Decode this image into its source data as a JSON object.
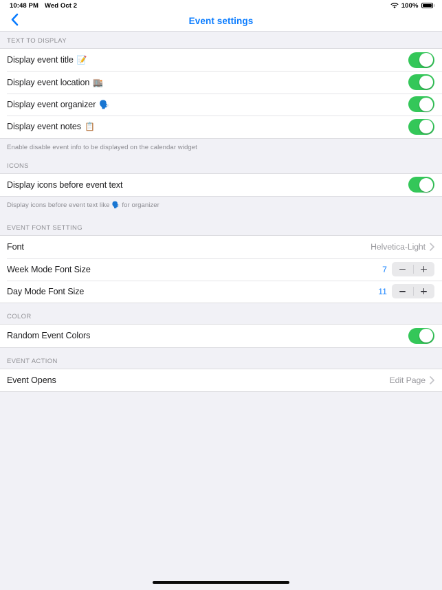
{
  "status_bar": {
    "time": "10:48 PM",
    "date": "Wed Oct 2",
    "wifi_icon": "wifi-icon",
    "battery_percent": "100%",
    "battery_icon": "battery-full-icon"
  },
  "nav": {
    "back_icon": "chevron-left-icon",
    "title": "Event settings",
    "title_color": "#0a7cff"
  },
  "sections": [
    {
      "header": "TEXT TO DISPLAY",
      "footer": "Enable disable event info to be displayed on the calendar widget",
      "rows": [
        {
          "label": "Display event title",
          "emoji": "📝",
          "emoji_name": "memo-emoji",
          "control": "toggle",
          "value": "on"
        },
        {
          "label": "Display event location",
          "emoji": "🏬",
          "emoji_name": "department-store-emoji",
          "control": "toggle",
          "value": "on"
        },
        {
          "label": "Display event organizer",
          "emoji": "🗣️",
          "emoji_name": "speaking-head-emoji",
          "control": "toggle",
          "value": "on"
        },
        {
          "label": "Display event notes",
          "emoji": "📋",
          "emoji_name": "clipboard-emoji",
          "control": "toggle",
          "value": "on"
        }
      ]
    },
    {
      "header": "ICONS",
      "footer_prefix": "Display icons before event text like",
      "footer_emoji": "🗣️",
      "footer_suffix": "for organizer",
      "rows": [
        {
          "label": "Display icons before event text",
          "control": "toggle",
          "value": "on"
        }
      ]
    },
    {
      "header": "EVENT FONT SETTING",
      "rows": [
        {
          "label": "Font",
          "control": "disclosure",
          "value": "Helvetica-Light"
        },
        {
          "label": "Week Mode Font Size",
          "control": "stepper",
          "value": "7",
          "minus_label": "−",
          "plus_label": "+"
        },
        {
          "label": "Day Mode Font Size",
          "control": "stepper",
          "value": "11",
          "minus_label": "−",
          "plus_label": "+"
        }
      ]
    },
    {
      "header": "COLOR",
      "rows": [
        {
          "label": "Random Event Colors",
          "control": "toggle",
          "value": "on"
        }
      ]
    },
    {
      "header": "EVENT ACTION",
      "rows": [
        {
          "label": "Event Opens",
          "control": "disclosure",
          "value": "Edit Page"
        }
      ]
    }
  ],
  "colors": {
    "accent": "#0a7cff",
    "toggle_on": "#34c759",
    "background": "#f1f1f6",
    "row_background": "#ffffff",
    "stepper_value": "#1a84ff",
    "secondary_text": "#8e8e93"
  },
  "home_indicator": "home-indicator"
}
